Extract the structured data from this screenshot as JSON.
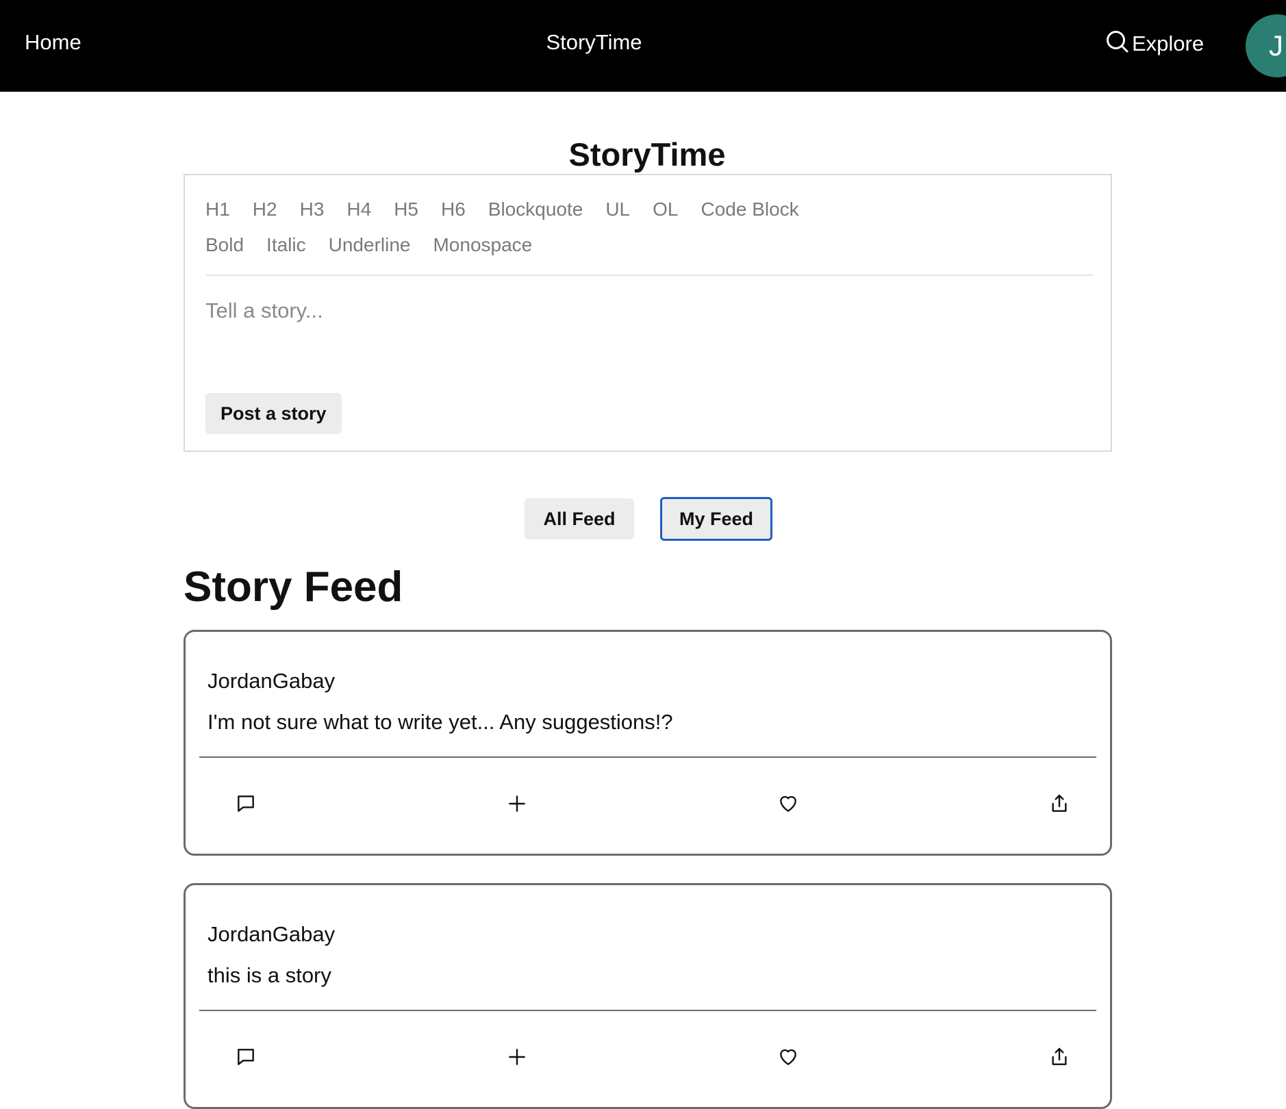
{
  "nav": {
    "home_label": "Home",
    "brand_label": "StoryTime",
    "explore_label": "Explore",
    "explore_icon": "search-icon",
    "avatar_initial": "J",
    "avatar_color": "#2b7f72"
  },
  "editor": {
    "title": "StoryTime",
    "toolbar_row1": [
      "H1",
      "H2",
      "H3",
      "H4",
      "H5",
      "H6",
      "Blockquote",
      "UL",
      "OL",
      "Code Block"
    ],
    "toolbar_row2": [
      "Bold",
      "Italic",
      "Underline",
      "Monospace"
    ],
    "placeholder": "Tell a story...",
    "value": "",
    "post_label": "Post a story"
  },
  "feed_tabs": {
    "all_label": "All Feed",
    "my_label": "My Feed",
    "selected": "My Feed",
    "focus_color": "#1f5fc2"
  },
  "feed": {
    "heading": "Story Feed",
    "stories": [
      {
        "author": "JordanGabay",
        "body": "I'm not sure what to write yet... Any suggestions!?",
        "actions": [
          "comment-icon",
          "plus-icon",
          "heart-icon",
          "share-icon"
        ]
      },
      {
        "author": "JordanGabay",
        "body": "this is a story",
        "actions": [
          "comment-icon",
          "plus-icon",
          "heart-icon",
          "share-icon"
        ]
      }
    ]
  }
}
